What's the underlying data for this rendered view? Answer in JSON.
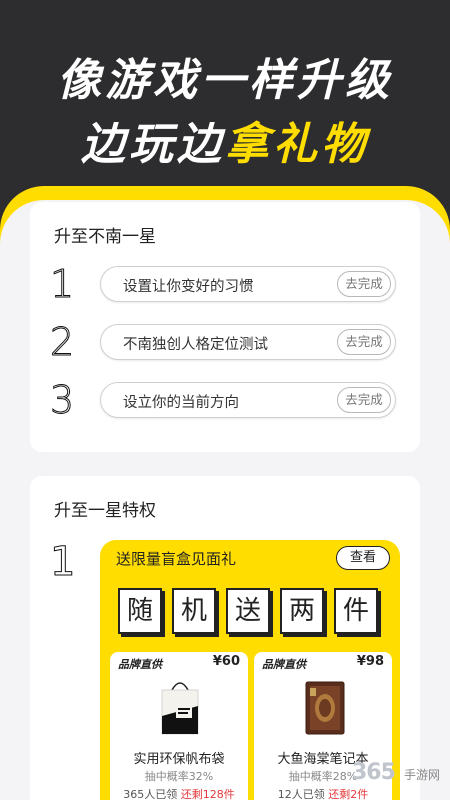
{
  "hero": {
    "line1": "像游戏一样升级",
    "line2_prefix": "边玩边",
    "line2_accent": "拿礼物"
  },
  "level_card": {
    "title": "升至不南一星",
    "steps": [
      {
        "num": "1",
        "label": "设置让你变好的习惯",
        "button": "去完成"
      },
      {
        "num": "2",
        "label": "不南独创人格定位测试",
        "button": "去完成"
      },
      {
        "num": "3",
        "label": "设立你的当前方向",
        "button": "去完成"
      }
    ]
  },
  "privilege_card": {
    "title": "升至一星特权",
    "num": "1",
    "gift": {
      "title": "送限量盲盒见面礼",
      "view_button": "查看",
      "tiles": [
        "随",
        "机",
        "送",
        "两",
        "件"
      ],
      "products": [
        {
          "brand": "品牌直供",
          "price": "¥60",
          "name": "实用环保帆布袋",
          "rate": "抽中概率32%",
          "claimed": "365人已领",
          "remaining": "还剩128件"
        },
        {
          "brand": "品牌直供",
          "price": "¥98",
          "name": "大鱼海棠笔记本",
          "rate": "抽中概率28%",
          "claimed": "12人已领",
          "remaining": "还剩2件"
        }
      ]
    }
  },
  "watermark": {
    "logo": "365",
    "text": "手游网"
  },
  "colors": {
    "accent": "#ffdd00",
    "dark": "#2d2d2f",
    "red": "#e4393c"
  }
}
